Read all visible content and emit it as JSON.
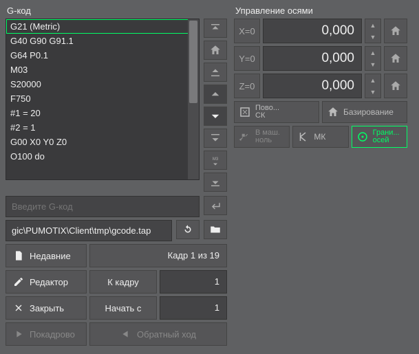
{
  "left": {
    "title": "G-код",
    "lines": [
      "G21 (Metric)",
      "G40 G90 G91.1",
      "G64 P0.1",
      "M03",
      "S20000",
      "F750",
      "#1 = 20",
      "#2 = 1",
      "G00 X0 Y0 Z0",
      "O100 do"
    ],
    "selected_index": 0,
    "input_placeholder": "Введите G-код",
    "file_path": "gic\\PUMOTIX\\Client\\tmp\\gcode.tap",
    "recent": "Недавние",
    "frame_info": "Кадр 1 из 19",
    "editor": "Редактор",
    "to_frame": "К кадру",
    "to_frame_val": "1",
    "close": "Закрыть",
    "start_from": "Начать с",
    "start_from_val": "1",
    "step": "Покадрово",
    "reverse": "Обратный ход"
  },
  "right": {
    "title": "Управление осями",
    "axes": [
      {
        "label": "X=0",
        "value": "0,000"
      },
      {
        "label": "Y=0",
        "value": "0,000"
      },
      {
        "label": "Z=0",
        "value": "0,000"
      }
    ],
    "turn_sk": "Пово...\nСК",
    "homing": "Базирование",
    "machine_zero": "В маш.\nноль",
    "mk": "МК",
    "bounds": "Грани...\nосей"
  }
}
